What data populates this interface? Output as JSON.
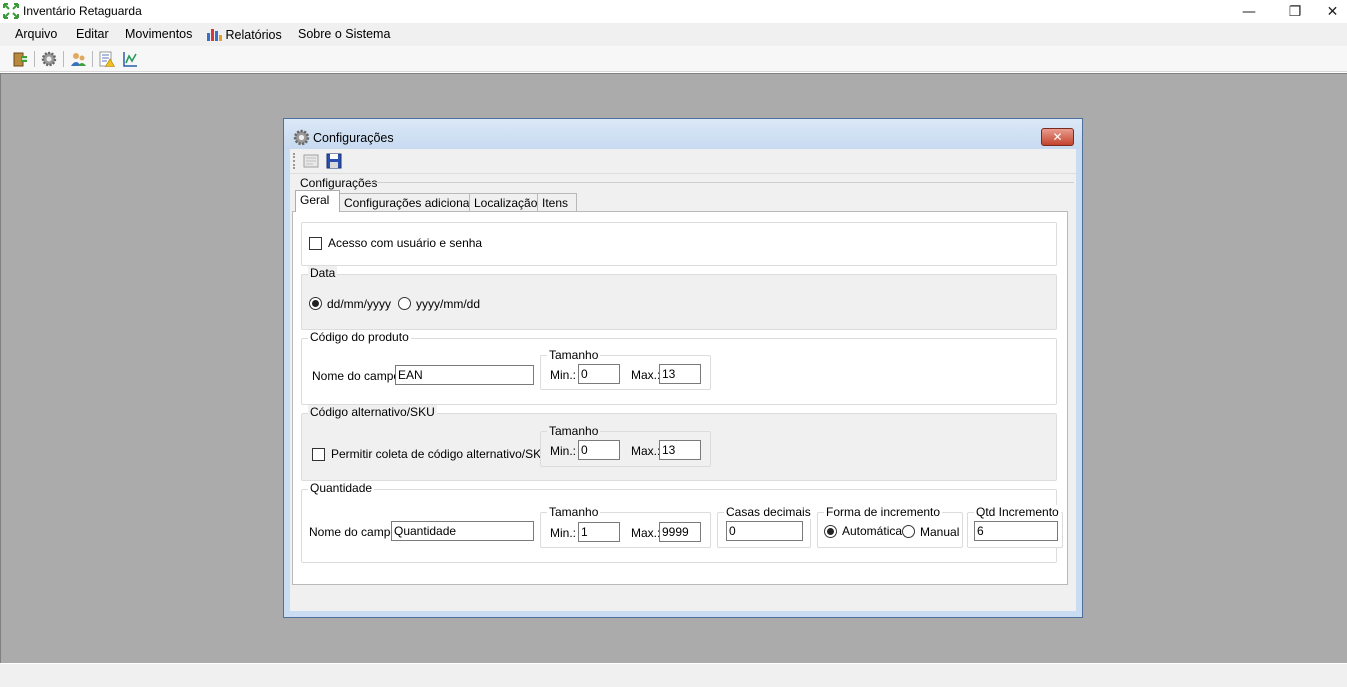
{
  "app": {
    "title": "Inventário Retaguarda",
    "window_controls": {
      "minimize": "—",
      "restore": "❐",
      "close": "✕"
    }
  },
  "menu": {
    "items": [
      "Arquivo",
      "Editar",
      "Movimentos",
      "Relatórios",
      "Sobre o Sistema"
    ],
    "reports_icon": "bar-chart-icon"
  },
  "toolbar": {
    "icons": [
      "exit-icon",
      "gear-icon",
      "users-icon",
      "report-warning-icon",
      "inventory-chart-icon"
    ]
  },
  "dialog": {
    "title": "Configurações",
    "close_label": "✕",
    "toolbar_icons": [
      "new-icon",
      "save-icon"
    ],
    "section_label": "Configurações",
    "tabs": [
      "Geral",
      "Configurações adicionais",
      "Localização",
      "Itens"
    ],
    "active_tab": "Geral",
    "access": {
      "label": "Acesso com usuário e senha",
      "checked": false
    },
    "date": {
      "legend": "Data",
      "options": [
        "dd/mm/yyyy",
        "yyyy/mm/dd"
      ],
      "selected": "dd/mm/yyyy"
    },
    "product_code": {
      "legend": "Código do produto",
      "field_label": "Nome do campo:",
      "field_value": "EAN",
      "size_legend": "Tamanho",
      "min_label": "Min.:",
      "min_value": "0",
      "max_label": "Max.:",
      "max_value": "13"
    },
    "sku": {
      "legend": "Código alternativo/SKU",
      "checkbox_label": "Permitir coleta de código alternativo/SKU",
      "checked": false,
      "size_legend": "Tamanho",
      "min_label": "Min.:",
      "min_value": "0",
      "max_label": "Max.:",
      "max_value": "13"
    },
    "quantity": {
      "legend": "Quantidade",
      "field_label": "Nome do campo:",
      "field_value": "Quantidade",
      "size_legend": "Tamanho",
      "min_label": "Min.:",
      "min_value": "1",
      "max_label": "Max.:",
      "max_value": "9999",
      "decimals_legend": "Casas decimais",
      "decimals_value": "0",
      "increment_legend": "Forma de incremento",
      "increment_options": [
        "Automática",
        "Manual"
      ],
      "increment_selected": "Automática",
      "qty_increment_legend": "Qtd Incremento",
      "qty_increment_value": "6"
    }
  }
}
